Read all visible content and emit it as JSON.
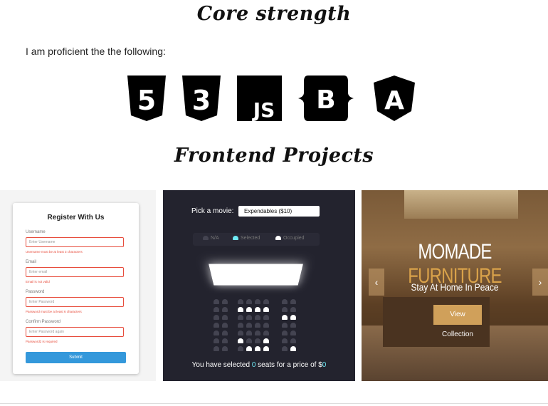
{
  "sections": {
    "skills_title": "Core strength",
    "intro": "I am proficient the the following:",
    "projects_title": "Frontend Projects"
  },
  "tech_icons": [
    {
      "name": "html5-icon",
      "glyph": "5"
    },
    {
      "name": "css3-icon",
      "glyph": "3"
    },
    {
      "name": "javascript-icon",
      "glyph": "JS"
    },
    {
      "name": "bootstrap-icon",
      "glyph": "B"
    },
    {
      "name": "angular-icon",
      "glyph": "A"
    }
  ],
  "register_form": {
    "title": "Register With Us",
    "fields": [
      {
        "label": "Username",
        "placeholder": "Enter Username",
        "error": "Username must be at least 3 characters"
      },
      {
        "label": "Email",
        "placeholder": "Enter email",
        "error": "Email is not valid"
      },
      {
        "label": "Password",
        "placeholder": "Enter Password",
        "error": "Password must be at least 6 characters"
      },
      {
        "label": "Confirm Password",
        "placeholder": "Enter Password again",
        "error": "Password2 is required"
      }
    ],
    "submit": "Submit"
  },
  "movie_booking": {
    "pick_label": "Pick a movie:",
    "selected_movie": "Expendables ($10)",
    "legend": [
      "N/A",
      "Selected",
      "Occupied"
    ],
    "summary_prefix": "You have selected ",
    "seat_count": "0",
    "summary_mid": " seats for a price of $",
    "price": "0",
    "colors": {
      "background": "#23232e",
      "selected": "#6feaf6",
      "occupied": "#ffffff",
      "available": "#444451"
    }
  },
  "furniture": {
    "brand_main": "MOMADE ",
    "brand_accent": "FURNITURE",
    "tagline": "Stay At Home In Peace",
    "cta": "View Collection",
    "prev_arrow": "‹",
    "next_arrow": "›"
  }
}
